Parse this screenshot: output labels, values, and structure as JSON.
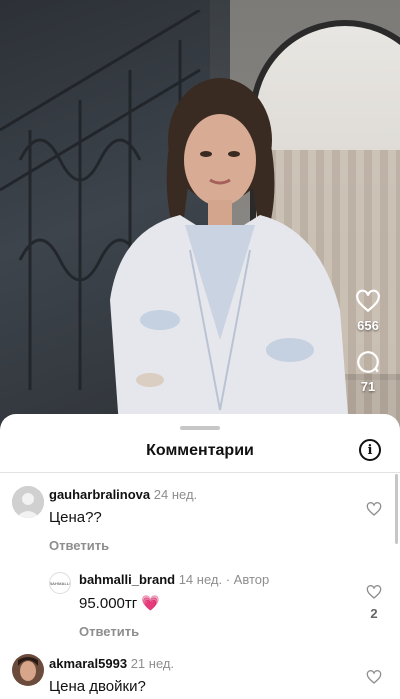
{
  "video": {
    "likes_count": "656",
    "comments_count": "71"
  },
  "comments_sheet": {
    "title": "Комментарии",
    "info_icon": "i"
  },
  "comments": [
    {
      "username": "gauharbralinova",
      "time": "24 нед.",
      "text": "Цена??",
      "reply_label": "Ответить",
      "avatar": "default-avatar"
    },
    {
      "username": "bahmalli_brand",
      "time": "14 нед.",
      "author_tag": "· Автор",
      "text": "95.000тг 💗",
      "reply_label": "Ответить",
      "like_count": "2",
      "avatar_text": "BAHMALLI"
    },
    {
      "username": "akmaral5993",
      "time": "21 нед.",
      "text": "Цена двойки?"
    }
  ],
  "colors": {
    "sheet_bg": "#ffffff",
    "muted": "#8e8e8e",
    "text": "#111111"
  }
}
